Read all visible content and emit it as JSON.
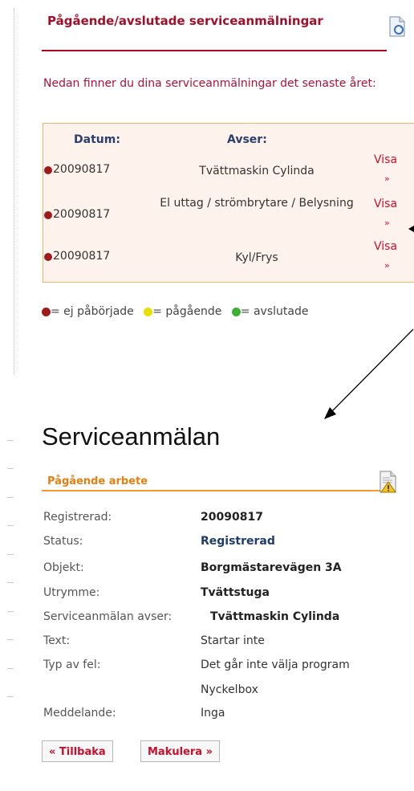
{
  "top": {
    "title": "Pågående/avslutade serviceanmälningar",
    "intro": "Nedan finner du dina serviceanmälningar det senaste året:"
  },
  "table": {
    "headers": {
      "date": "Datum:",
      "avser": "Avser:"
    },
    "rows": [
      {
        "date": "20090817",
        "avser": "Tvättmaskin Cylinda",
        "action": "Visa",
        "arrow": "»",
        "status_color": "#a01a1a"
      },
      {
        "date": "20090817",
        "avser": "El uttag / strömbrytare / Belysning",
        "action": "Visa",
        "arrow": "»",
        "status_color": "#a01a1a"
      },
      {
        "date": "20090817",
        "avser": "Kyl/Frys",
        "action": "Visa",
        "arrow": "»",
        "status_color": "#a01a1a"
      }
    ]
  },
  "legend": {
    "items": [
      {
        "text": "= ej påbörjade",
        "color": "#a01a1a"
      },
      {
        "text": "= pågående",
        "color": "#e8e000"
      },
      {
        "text": "= avslutade",
        "color": "#3cb030"
      }
    ]
  },
  "detail": {
    "heading": "Serviceanmälan",
    "section_title": "Pågående arbete",
    "fields": [
      {
        "label": "Registrerad:",
        "value": "20090817",
        "style": "b"
      },
      {
        "label": "Status:",
        "value": "Registrerad",
        "style": "blue"
      },
      {
        "label": "Objekt:",
        "value": "Borgmästarevägen 3A",
        "style": "b"
      },
      {
        "label": "Utrymme:",
        "value": "Tvättstuga",
        "style": "b"
      },
      {
        "label": "Serviceanmälan avser:",
        "value": "Tvättmaskin Cylinda",
        "style": "b"
      },
      {
        "label": "Text:",
        "value": "Startar inte",
        "style": ""
      },
      {
        "label": "Typ av fel:",
        "value": "Det går inte välja program",
        "style": ""
      },
      {
        "label": "",
        "value": "Nyckelbox",
        "style": ""
      },
      {
        "label": "Meddelande:",
        "value": "Inga",
        "style": ""
      }
    ],
    "buttons": {
      "back": "« Tillbaka",
      "cancel": "Makulera »"
    }
  },
  "icons": {
    "top": "document-refresh-icon",
    "detail": "document-warning-icon"
  }
}
